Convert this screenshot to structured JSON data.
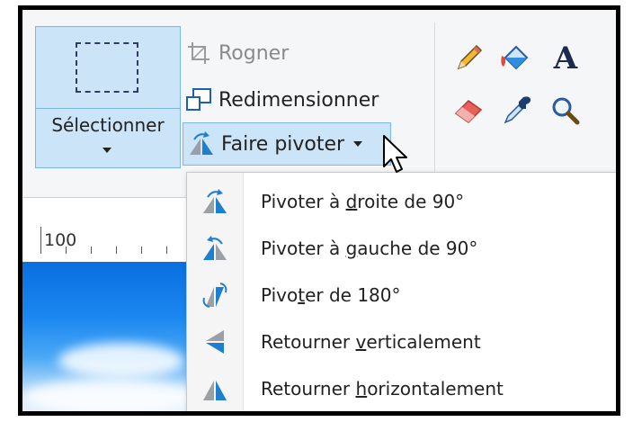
{
  "image": {
    "select": {
      "label": "Sélectionner"
    },
    "crop_label": "Rogner",
    "resize_label": "Redimensionner",
    "rotate_label": "Faire pivoter"
  },
  "tools": [
    "pencil-icon",
    "fill-bucket-icon",
    "text-tool-icon",
    "eraser-icon",
    "color-picker-icon",
    "magnifier-icon"
  ],
  "tools_text_glyph": "A",
  "ruler": {
    "label": "100"
  },
  "rotate_menu": {
    "items": [
      {
        "pre": "Pivoter à ",
        "key": "d",
        "post": "roite de 90°",
        "icon": "rotate-right-icon"
      },
      {
        "pre": "Pivoter à ",
        "key": "g",
        "post": "auche de 90°",
        "icon": "rotate-left-icon"
      },
      {
        "pre": "Pivo",
        "key": "t",
        "post": "er de 180°",
        "icon": "rotate-180-icon"
      },
      {
        "pre": "Retourner ",
        "key": "v",
        "post": "erticalement",
        "icon": "flip-vertical-icon"
      },
      {
        "pre": "Retourner ",
        "key": "h",
        "post": "orizontalement",
        "icon": "flip-horizontal-icon"
      }
    ]
  },
  "colors": {
    "selected_bg": "#cce4f7",
    "selected_border": "#7ab6e6",
    "icon_blue": "#1e7fd0",
    "icon_gray": "#9aa0a6"
  }
}
